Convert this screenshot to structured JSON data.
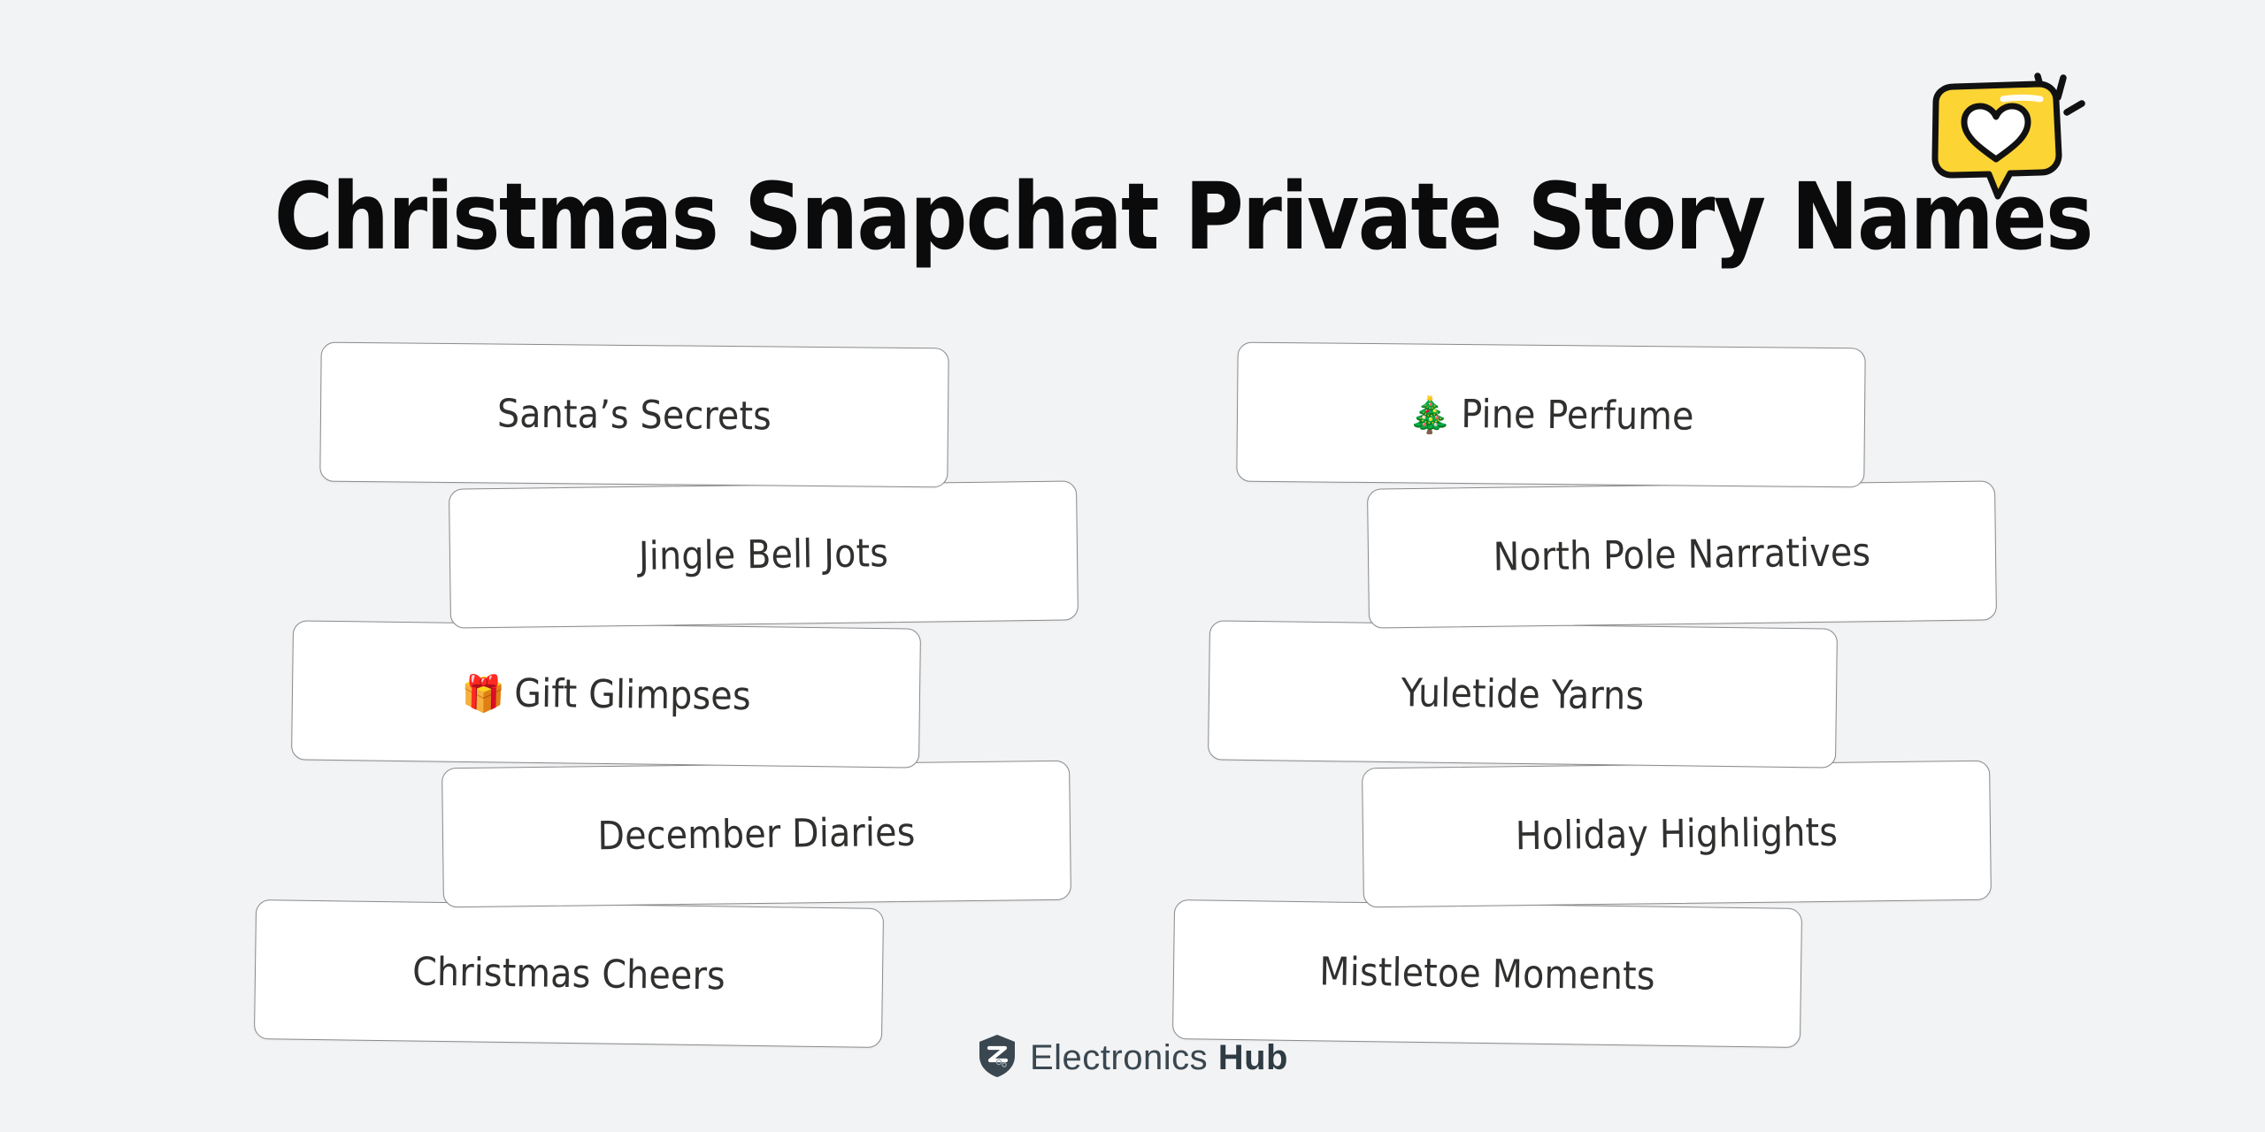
{
  "page": {
    "title": "Christmas Snapchat Private Story Names",
    "background_color": "#F2F3F5",
    "text_color": "#30302F"
  },
  "badge": {
    "icon": "speech-bubble-heart-icon",
    "bubble_color": "#FCD434",
    "heart_color": "#FFFFFF",
    "outline_color": "#111111"
  },
  "columns": [
    {
      "id": "left",
      "cards": [
        {
          "emoji": "",
          "label": "Santa’s Secrets"
        },
        {
          "emoji": "",
          "label": "Jingle Bell Jots"
        },
        {
          "emoji": "🎁",
          "label": "Gift Glimpses"
        },
        {
          "emoji": "",
          "label": "December Diaries"
        },
        {
          "emoji": "",
          "label": "Christmas Cheers"
        }
      ]
    },
    {
      "id": "right",
      "cards": [
        {
          "emoji": "🎄",
          "label": "Pine Perfume"
        },
        {
          "emoji": "",
          "label": "North Pole Narratives"
        },
        {
          "emoji": "",
          "label": "Yuletide Yarns"
        },
        {
          "emoji": "",
          "label": "Holiday Highlights"
        },
        {
          "emoji": "",
          "label": "Mistletoe Moments"
        }
      ]
    }
  ],
  "footer": {
    "logo_icon": "shield-logo-icon",
    "brand_light": "Electronics",
    "brand_bold": "Hub",
    "brand_color": "#3A4750"
  }
}
